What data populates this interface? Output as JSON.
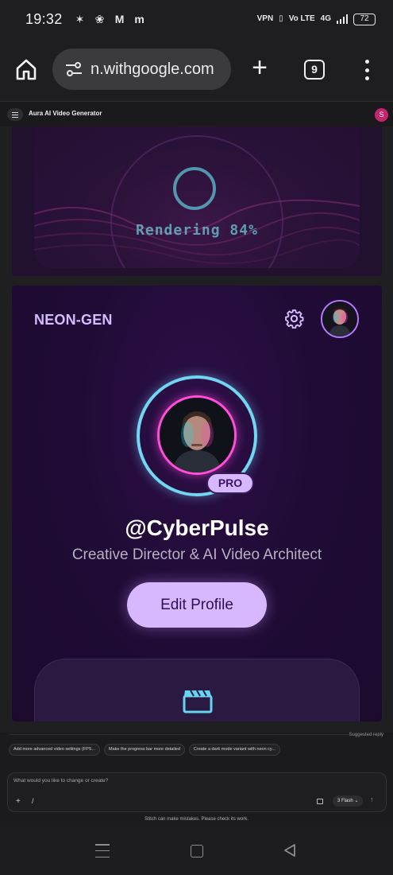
{
  "status_bar": {
    "time": "19:32",
    "app_icons": [
      "✶",
      "❀",
      "M",
      "m"
    ],
    "vpn": "VPN",
    "volte": "Vo LTE",
    "network": "4G",
    "battery": "72"
  },
  "browser": {
    "url": "n.withgoogle.com",
    "tab_count": "9",
    "new_tab_symbol": "+"
  },
  "app_header": {
    "title": "Aura AI Video Generator",
    "user_initial": "S"
  },
  "render_preview": {
    "status_text": "Rendering 84%",
    "progress_percent": 84
  },
  "profile": {
    "brand": "NEON-GEN",
    "badge": "PRO",
    "handle": "@CyberPulse",
    "role": "Creative Director & AI Video Architect",
    "edit_button": "Edit Profile"
  },
  "assistant": {
    "suggested_label": "Suggested reply",
    "suggestions": [
      "Add more advanced video settings (FPS...",
      "Make the progress bar more detailed",
      "Create a dark mode variant with neon cy..."
    ],
    "prompt_placeholder": "What would you like to change or create?",
    "add_symbol": "+",
    "slash_symbol": "/",
    "model": "3 Flash ⌄",
    "send_symbol": "↑",
    "disclaimer": "Stitch can make mistakes. Please check its work."
  },
  "colors": {
    "accent_lavender": "#d7b8ff",
    "neon_cyan": "#73d6f0",
    "neon_pink": "#ff4fd8",
    "card_purple": "#200b36",
    "avatar_magenta": "#c6246e"
  }
}
